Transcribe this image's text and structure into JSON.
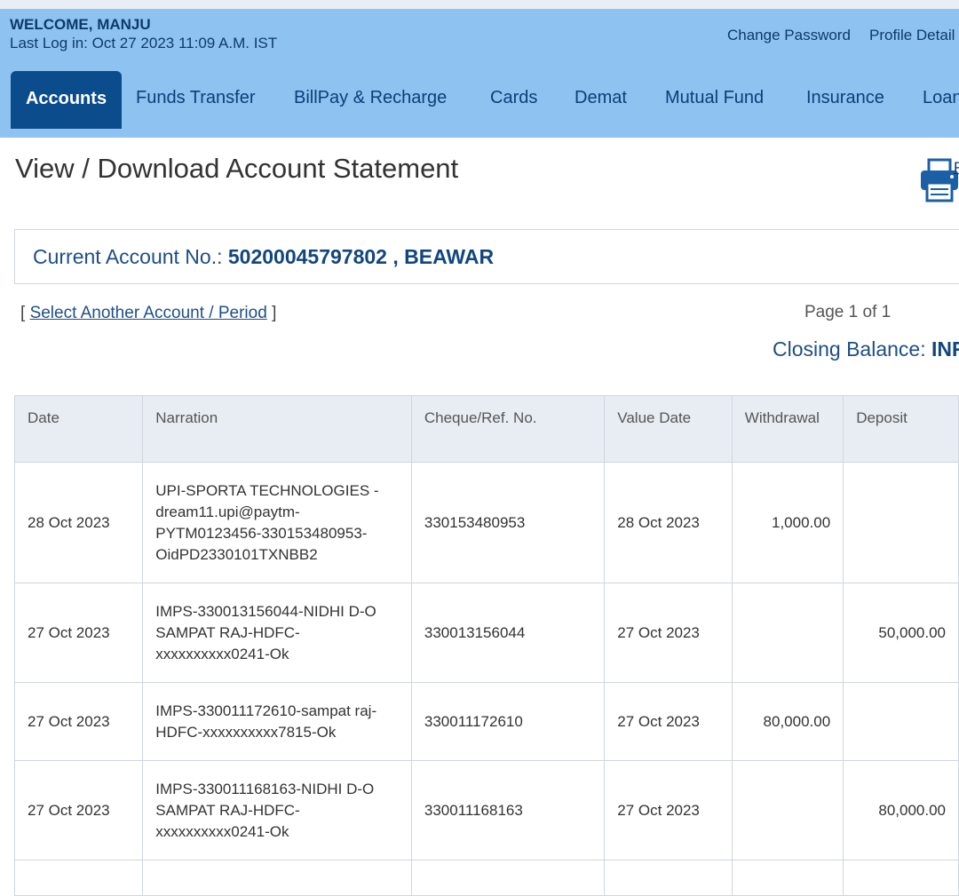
{
  "header": {
    "welcome": "WELCOME, MANJU",
    "last_login": "Last Log in: Oct 27 2023 11:09 A.M. IST",
    "links": [
      "Change Password",
      "Profile Detail"
    ]
  },
  "nav": {
    "tabs": [
      "Accounts",
      "Funds Transfer",
      "BillPay & Recharge",
      "Cards",
      "Demat",
      "Mutual Fund",
      "Insurance",
      "Loan"
    ],
    "active": "Accounts"
  },
  "page": {
    "title": "View / Download Account Statement",
    "print_label": "P"
  },
  "account": {
    "label": "Current Account No.: ",
    "number_branch": "50200045797802 , BEAWAR"
  },
  "controls": {
    "select_open": "[ ",
    "select_link": "Select Another Account / Period",
    "select_close": " ]",
    "page_info": "Page 1 of 1",
    "closing_label": "Closing Balance: ",
    "closing_value": "INR"
  },
  "table": {
    "headers": [
      "Date",
      "Narration",
      "Cheque/Ref. No.",
      "Value Date",
      "Withdrawal",
      "Deposit"
    ],
    "rows": [
      {
        "date": "28 Oct 2023",
        "narration": "UPI-SPORTA TECHNOLOGIES - dream11.upi@paytm-PYTM0123456-330153480953-OidPD2330101TXNBB2",
        "ref": "330153480953",
        "value_date": "28 Oct 2023",
        "withdrawal": "1,000.00",
        "deposit": ""
      },
      {
        "date": "27 Oct 2023",
        "narration": "IMPS-330013156044-NIDHI D-O SAMPAT RAJ-HDFC-xxxxxxxxxx0241-Ok",
        "ref": "330013156044",
        "value_date": "27 Oct 2023",
        "withdrawal": "",
        "deposit": "50,000.00"
      },
      {
        "date": "27 Oct 2023",
        "narration": "IMPS-330011172610-sampat raj-HDFC-xxxxxxxxxx7815-Ok",
        "ref": "330011172610",
        "value_date": "27 Oct 2023",
        "withdrawal": "80,000.00",
        "deposit": ""
      },
      {
        "date": "27 Oct 2023",
        "narration": "IMPS-330011168163-NIDHI D-O SAMPAT RAJ-HDFC-xxxxxxxxxx0241-Ok",
        "ref": "330011168163",
        "value_date": "27 Oct 2023",
        "withdrawal": "",
        "deposit": "80,000.00"
      }
    ]
  },
  "colors": {
    "header_bg": "#8ec2f0",
    "active_tab": "#0b4c8c",
    "link": "#1d4f86"
  }
}
